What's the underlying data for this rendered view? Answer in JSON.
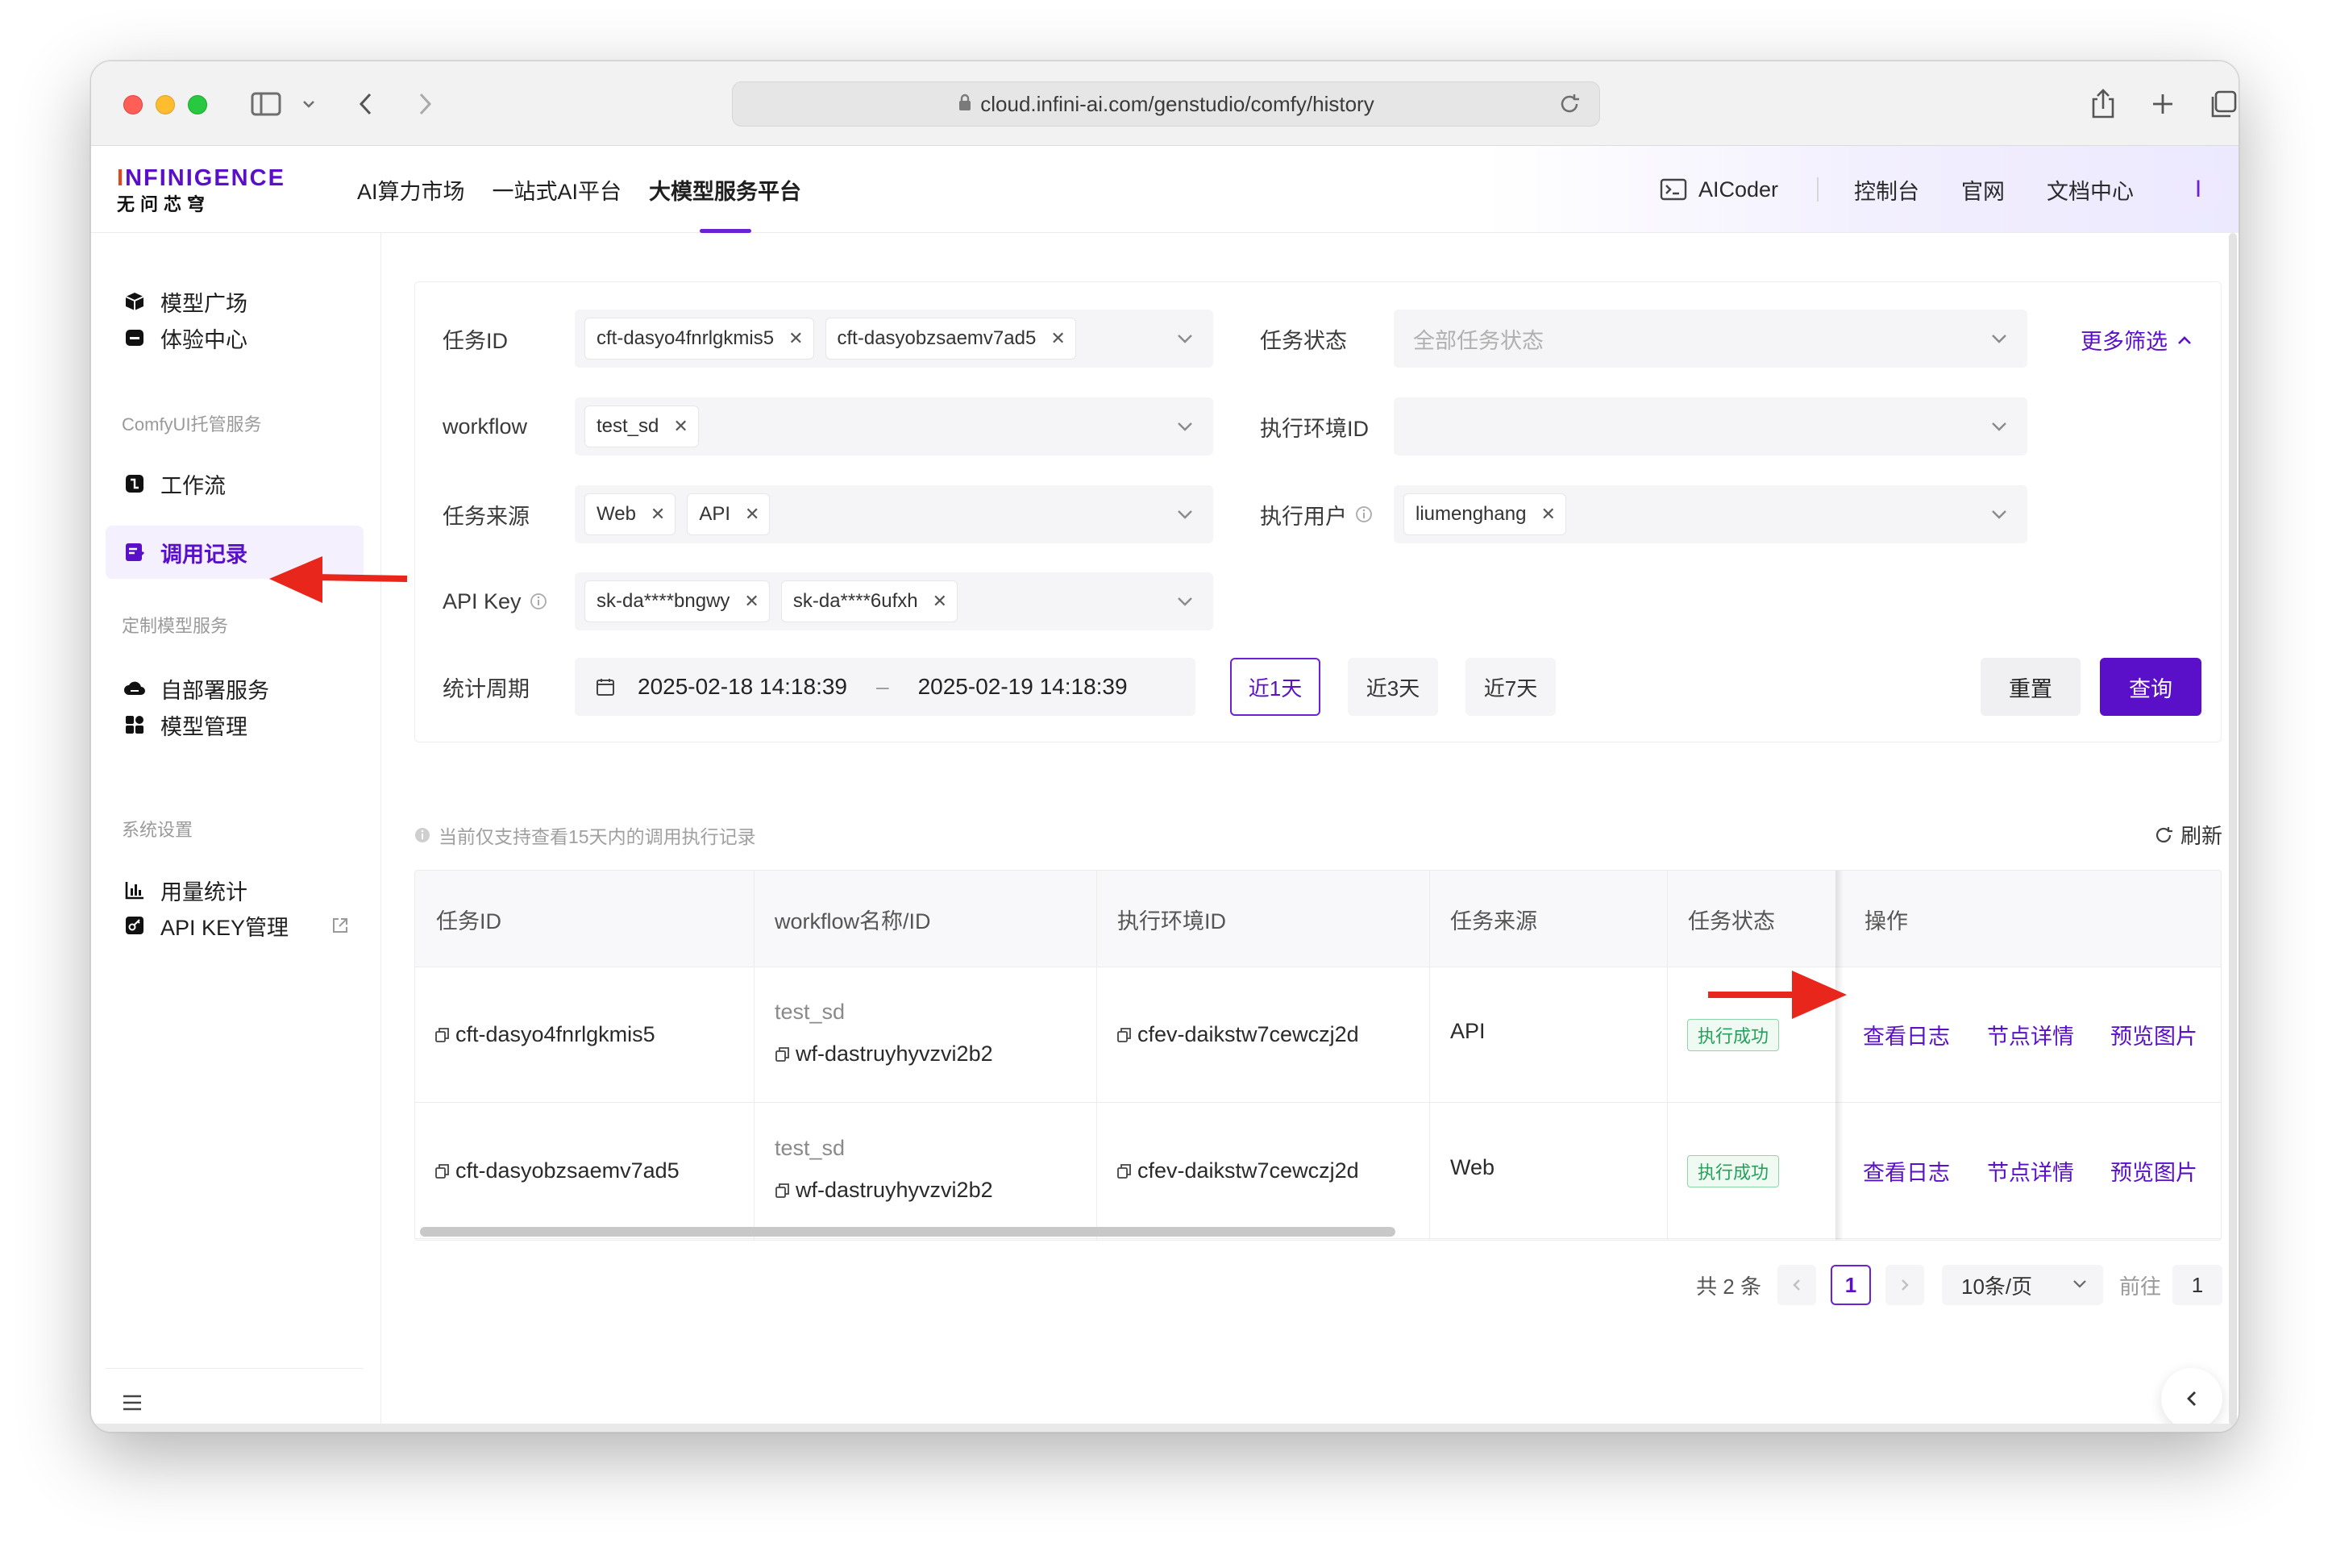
{
  "browser": {
    "url": "cloud.infini-ai.com/genstudio/comfy/history"
  },
  "header": {
    "logo_main": "INFINIGENCE",
    "logo_sub": "无问芯穹",
    "nav": [
      "AI算力市场",
      "一站式AI平台",
      "大模型服务平台"
    ],
    "active_nav": "大模型服务平台",
    "aicoder": "AICoder",
    "right_links": [
      "控制台",
      "官网",
      "文档中心"
    ],
    "avatar_letter": "I"
  },
  "sidebar": {
    "items": [
      {
        "label": "模型广场",
        "icon": "cube-icon"
      },
      {
        "label": "体验中心",
        "icon": "chat-icon"
      },
      {
        "section": "ComfyUI托管服务"
      },
      {
        "label": "工作流",
        "icon": "workflow-icon"
      },
      {
        "label": "调用记录",
        "icon": "record-icon",
        "active": true
      },
      {
        "section": "定制模型服务"
      },
      {
        "label": "自部署服务",
        "icon": "cloud-icon"
      },
      {
        "label": "模型管理",
        "icon": "grid-icon"
      },
      {
        "section": "系统设置"
      },
      {
        "label": "用量统计",
        "icon": "chart-icon"
      },
      {
        "label": "API KEY管理",
        "icon": "key-icon"
      }
    ]
  },
  "filters": {
    "task_id_label": "任务ID",
    "task_id_tags": [
      "cft-dasyo4fnrlgkmis5",
      "cft-dasyobzsaemv7ad5"
    ],
    "task_status_label": "任务状态",
    "task_status_placeholder": "全部任务状态",
    "more_filter": "更多筛选",
    "workflow_label": "workflow",
    "workflow_tags": [
      "test_sd"
    ],
    "env_label": "执行环境ID",
    "source_label": "任务来源",
    "source_tags": [
      "Web",
      "API"
    ],
    "user_label": "执行用户",
    "user_tags": [
      "liumenghang"
    ],
    "apikey_label": "API Key",
    "apikey_tags": [
      "sk-da****bngwy",
      "sk-da****6ufxh"
    ],
    "period_label": "统计周期",
    "date_start": "2025-02-18 14:18:39",
    "date_sep": "–",
    "date_end": "2025-02-19 14:18:39",
    "ranges": [
      "近1天",
      "近3天",
      "近7天"
    ],
    "selected_range": "近1天",
    "reset": "重置",
    "query": "查询"
  },
  "notice": "当前仅支持查看15天内的调用执行记录",
  "refresh": "刷新",
  "table": {
    "columns": [
      "任务ID",
      "workflow名称/ID",
      "执行环境ID",
      "任务来源",
      "任务状态",
      "操作"
    ],
    "rows": [
      {
        "task_id": "cft-dasyo4fnrlgkmis5",
        "workflow_name": "test_sd",
        "workflow_id": "wf-dastruyhyvzvi2b2",
        "env_id": "cfev-daikstw7cewczj2d",
        "source": "API",
        "status": "执行成功",
        "ops": [
          "查看日志",
          "节点详情",
          "预览图片"
        ]
      },
      {
        "task_id": "cft-dasyobzsaemv7ad5",
        "workflow_name": "test_sd",
        "workflow_id": "wf-dastruyhyvzvi2b2",
        "env_id": "cfev-daikstw7cewczj2d",
        "source": "Web",
        "status": "执行成功",
        "ops": [
          "查看日志",
          "节点详情",
          "预览图片"
        ]
      }
    ]
  },
  "pagination": {
    "total": "共 2 条",
    "current": "1",
    "page_size": "10条/页",
    "goto_label": "前往",
    "goto_value": "1"
  },
  "colors": {
    "accent": "#5a10c9",
    "success": "#26a05a",
    "arrow": "#e8261c"
  }
}
